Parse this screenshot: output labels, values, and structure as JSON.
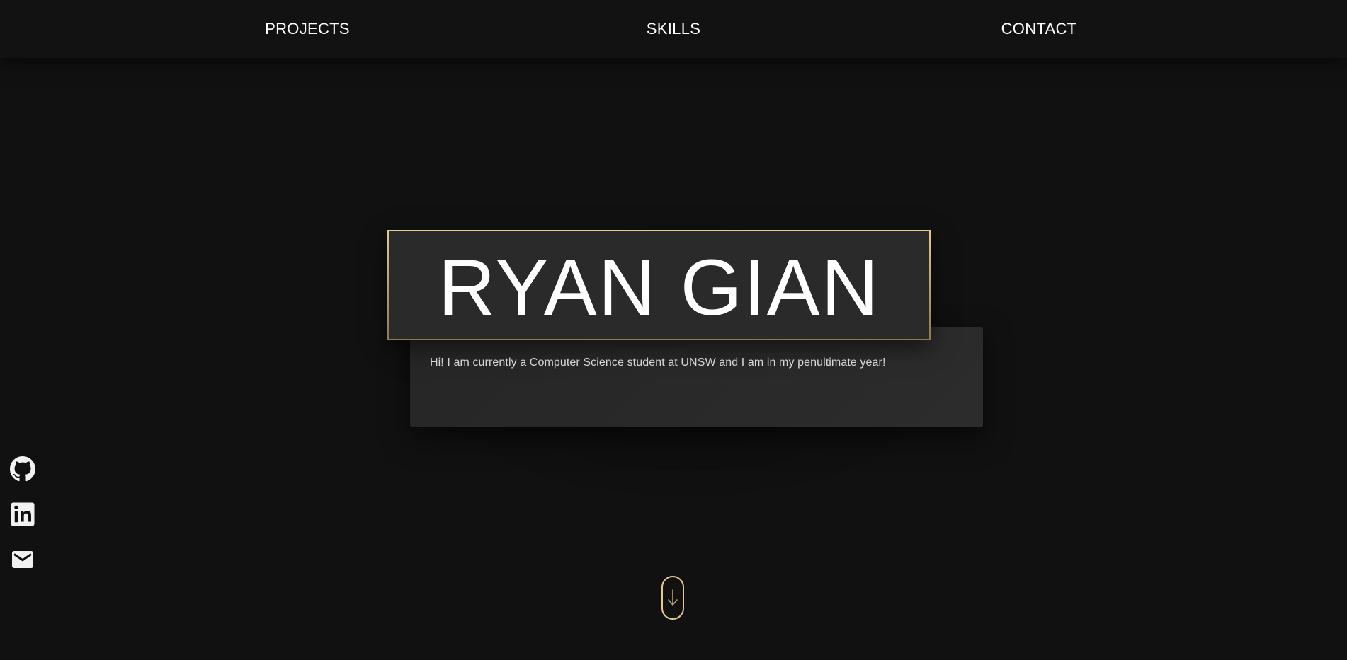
{
  "nav": {
    "items": [
      {
        "label": "PROJECTS"
      },
      {
        "label": "SKILLS"
      },
      {
        "label": "CONTACT"
      }
    ]
  },
  "hero": {
    "name": "RYAN GIAN",
    "bio": "Hi! I am currently a Computer Science student at UNSW and I am in my penultimate year!"
  },
  "social": {
    "icons": [
      "github-icon",
      "linkedin-icon",
      "mail-icon"
    ]
  },
  "scroll": {
    "icon": "arrow-down-icon"
  },
  "colors": {
    "background": "#111111",
    "card": "#2a2a2a",
    "accent_gold": "#e6c891",
    "text": "#ffffff"
  }
}
